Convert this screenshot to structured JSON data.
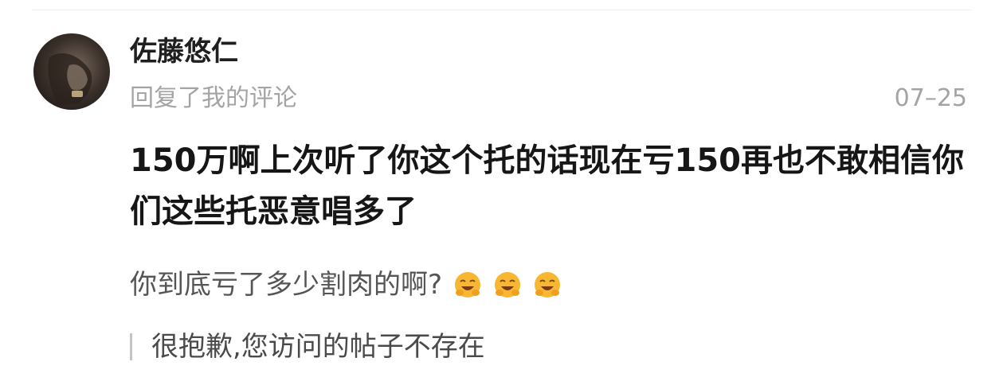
{
  "comment": {
    "username": "佐藤悠仁",
    "reply_meta": "回复了我的评论",
    "timestamp": "07–25",
    "body": "150万啊上次听了你这个托的话现在亏150再也不敢相信你们这些托恶意唱多了",
    "avatar_icon": "user-avatar-photo"
  },
  "quoted_comment": {
    "text": "你到底亏了多少割肉的啊?",
    "emojis": [
      "laughing-face-icon",
      "laughing-face-icon",
      "laughing-face-icon"
    ]
  },
  "notice": {
    "text": "很抱歉,您访问的帖子不存在"
  },
  "colors": {
    "username": "#1f1f1f",
    "meta": "#a4a4a4",
    "body": "#161616",
    "quote": "#555555",
    "notice_bar": "#c4c4c4",
    "emoji": "#f5a623"
  }
}
